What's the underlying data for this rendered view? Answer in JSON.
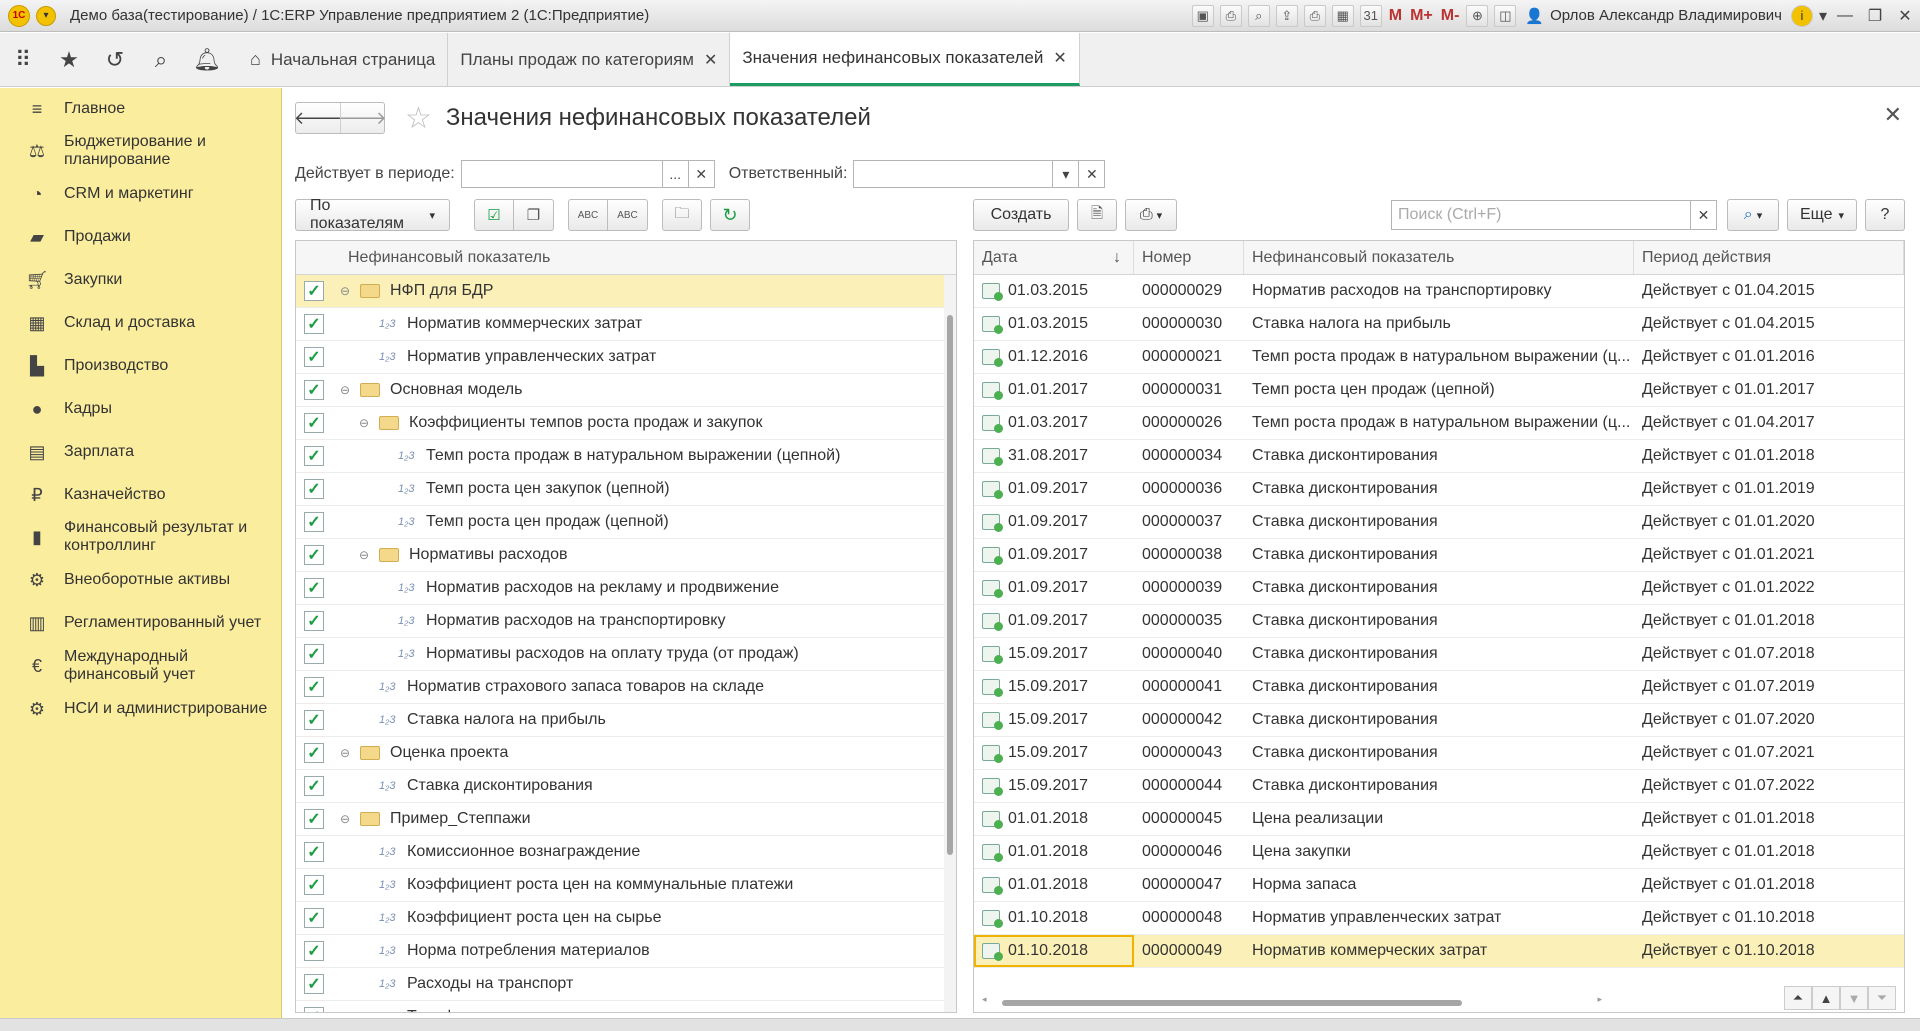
{
  "window": {
    "title": "Демо база(тестирование) / 1С:ERP Управление предприятием 2  (1С:Предприятие)",
    "user": "Орлов Александр Владимирович",
    "m_buttons": [
      "M",
      "M+",
      "M-"
    ]
  },
  "tabs": [
    {
      "label": "Начальная страница"
    },
    {
      "label": "Планы продаж по категориям"
    },
    {
      "label": "Значения нефинансовых показателей"
    }
  ],
  "sidebar": {
    "items": [
      {
        "label": "Главное",
        "icon": "menu-icon"
      },
      {
        "label": "Бюджетирование и планирование",
        "icon": "budget-icon"
      },
      {
        "label": "CRM и маркетинг",
        "icon": "crm-icon"
      },
      {
        "label": "Продажи",
        "icon": "sales-icon"
      },
      {
        "label": "Закупки",
        "icon": "cart-icon"
      },
      {
        "label": "Склад и доставка",
        "icon": "warehouse-icon"
      },
      {
        "label": "Производство",
        "icon": "factory-icon"
      },
      {
        "label": "Кадры",
        "icon": "person-icon"
      },
      {
        "label": "Зарплата",
        "icon": "salary-icon"
      },
      {
        "label": "Казначейство",
        "icon": "treasury-icon"
      },
      {
        "label": "Финансовый результат и контроллинг",
        "icon": "chart-icon"
      },
      {
        "label": "Внеоборотные активы",
        "icon": "assets-icon"
      },
      {
        "label": "Регламентированный учет",
        "icon": "accounting-icon"
      },
      {
        "label": "Международный финансовый учет",
        "icon": "ifrs-icon"
      },
      {
        "label": "НСИ и администрирование",
        "icon": "gear-icon"
      }
    ]
  },
  "form": {
    "title": "Значения нефинансовых показателей",
    "period_label": "Действует в периоде:",
    "period_value": "",
    "responsible_label": "Ответственный:",
    "responsible_value": "",
    "group_by_button": "По показателям",
    "create_button": "Создать",
    "search_placeholder": "Поиск (Ctrl+F)",
    "more_button": "Еще",
    "help_button": "?",
    "select_button": "..."
  },
  "tree": {
    "header": "Нефинансовый показатель",
    "rows": [
      {
        "label": "НФП для БДР",
        "type": "folder",
        "level": 0,
        "expanded": true,
        "checked": true,
        "selected": true
      },
      {
        "label": "Норматив коммерческих затрат",
        "type": "metric",
        "level": 1,
        "checked": true
      },
      {
        "label": "Норматив управленческих затрат",
        "type": "metric",
        "level": 1,
        "checked": true
      },
      {
        "label": "Основная модель",
        "type": "folder",
        "level": 0,
        "expanded": true,
        "checked": true
      },
      {
        "label": "Коэффициенты темпов роста продаж и закупок",
        "type": "folder",
        "level": 1,
        "expanded": true,
        "checked": true
      },
      {
        "label": "Темп роста продаж в натуральном выражении (цепной)",
        "type": "metric",
        "level": 2,
        "checked": true
      },
      {
        "label": "Темп роста цен закупок (цепной)",
        "type": "metric",
        "level": 2,
        "checked": true
      },
      {
        "label": "Темп роста цен продаж (цепной)",
        "type": "metric",
        "level": 2,
        "checked": true
      },
      {
        "label": "Нормативы расходов",
        "type": "folder",
        "level": 1,
        "expanded": true,
        "checked": true
      },
      {
        "label": "Норматив расходов на рекламу и продвижение",
        "type": "metric",
        "level": 2,
        "checked": true
      },
      {
        "label": "Норматив расходов на транспортировку",
        "type": "metric",
        "level": 2,
        "checked": true
      },
      {
        "label": "Нормативы расходов на оплату труда (от продаж)",
        "type": "metric",
        "level": 2,
        "checked": true
      },
      {
        "label": "Норматив страхового запаса товаров на складе",
        "type": "metric",
        "level": 1,
        "checked": true
      },
      {
        "label": "Ставка налога на прибыль",
        "type": "metric",
        "level": 1,
        "checked": true
      },
      {
        "label": "Оценка проекта",
        "type": "folder",
        "level": 0,
        "expanded": true,
        "checked": true
      },
      {
        "label": "Ставка дисконтирования",
        "type": "metric",
        "level": 1,
        "checked": true
      },
      {
        "label": "Пример_Степпажи",
        "type": "folder",
        "level": 0,
        "expanded": true,
        "checked": true
      },
      {
        "label": "Комиссионное вознаграждение",
        "type": "metric",
        "level": 1,
        "checked": true
      },
      {
        "label": "Коэффициент роста цен на коммунальные платежи",
        "type": "metric",
        "level": 1,
        "checked": true
      },
      {
        "label": "Коэффициент роста цен на сырье",
        "type": "metric",
        "level": 1,
        "checked": true
      },
      {
        "label": "Норма потребления материалов",
        "type": "metric",
        "level": 1,
        "checked": true
      },
      {
        "label": "Расходы на транспорт",
        "type": "metric",
        "level": 1,
        "checked": true
      },
      {
        "label": "Тарифная ставка за единицу продукции",
        "type": "metric",
        "level": 1,
        "checked": true
      }
    ]
  },
  "grid": {
    "columns": [
      "Дата",
      "Номер",
      "Нефинансовый показатель",
      "Период действия"
    ],
    "sort_indicator": "↓",
    "rows": [
      {
        "date": "01.03.2015",
        "number": "000000029",
        "metric": "Норматив расходов на транспортировку",
        "period": "Действует с 01.04.2015"
      },
      {
        "date": "01.03.2015",
        "number": "000000030",
        "metric": "Ставка налога на прибыль",
        "period": "Действует с 01.04.2015"
      },
      {
        "date": "01.12.2016",
        "number": "000000021",
        "metric": "Темп роста продаж в натуральном выражении (ц...",
        "period": "Действует с 01.01.2016"
      },
      {
        "date": "01.01.2017",
        "number": "000000031",
        "metric": "Темп роста цен продаж (цепной)",
        "period": "Действует с 01.01.2017"
      },
      {
        "date": "01.03.2017",
        "number": "000000026",
        "metric": "Темп роста продаж в натуральном выражении (ц...",
        "period": "Действует с 01.04.2017"
      },
      {
        "date": "31.08.2017",
        "number": "000000034",
        "metric": "Ставка дисконтирования",
        "period": "Действует с 01.01.2018"
      },
      {
        "date": "01.09.2017",
        "number": "000000036",
        "metric": "Ставка дисконтирования",
        "period": "Действует с 01.01.2019"
      },
      {
        "date": "01.09.2017",
        "number": "000000037",
        "metric": "Ставка дисконтирования",
        "period": "Действует с 01.01.2020"
      },
      {
        "date": "01.09.2017",
        "number": "000000038",
        "metric": "Ставка дисконтирования",
        "period": "Действует с 01.01.2021"
      },
      {
        "date": "01.09.2017",
        "number": "000000039",
        "metric": "Ставка дисконтирования",
        "period": "Действует с 01.01.2022"
      },
      {
        "date": "01.09.2017",
        "number": "000000035",
        "metric": "Ставка дисконтирования",
        "period": "Действует с 01.01.2018"
      },
      {
        "date": "15.09.2017",
        "number": "000000040",
        "metric": "Ставка дисконтирования",
        "period": "Действует с 01.07.2018"
      },
      {
        "date": "15.09.2017",
        "number": "000000041",
        "metric": "Ставка дисконтирования",
        "period": "Действует с 01.07.2019"
      },
      {
        "date": "15.09.2017",
        "number": "000000042",
        "metric": "Ставка дисконтирования",
        "period": "Действует с 01.07.2020"
      },
      {
        "date": "15.09.2017",
        "number": "000000043",
        "metric": "Ставка дисконтирования",
        "period": "Действует с 01.07.2021"
      },
      {
        "date": "15.09.2017",
        "number": "000000044",
        "metric": "Ставка дисконтирования",
        "period": "Действует с 01.07.2022"
      },
      {
        "date": "01.01.2018",
        "number": "000000045",
        "metric": "Цена реализации",
        "period": "Действует с 01.01.2018"
      },
      {
        "date": "01.01.2018",
        "number": "000000046",
        "metric": "Цена закупки",
        "period": "Действует с 01.01.2018"
      },
      {
        "date": "01.01.2018",
        "number": "000000047",
        "metric": "Норма запаса",
        "period": "Действует с 01.01.2018"
      },
      {
        "date": "01.10.2018",
        "number": "000000048",
        "metric": "Норматив управленческих затрат",
        "period": "Действует с 01.10.2018"
      },
      {
        "date": "01.10.2018",
        "number": "000000049",
        "metric": "Норматив коммерческих затрат",
        "period": "Действует с 01.10.2018",
        "selected": true
      }
    ]
  },
  "colors": {
    "sidebar_bg": "#fbed9e",
    "accent": "#1a9c62",
    "selection": "#fbf0b8"
  }
}
